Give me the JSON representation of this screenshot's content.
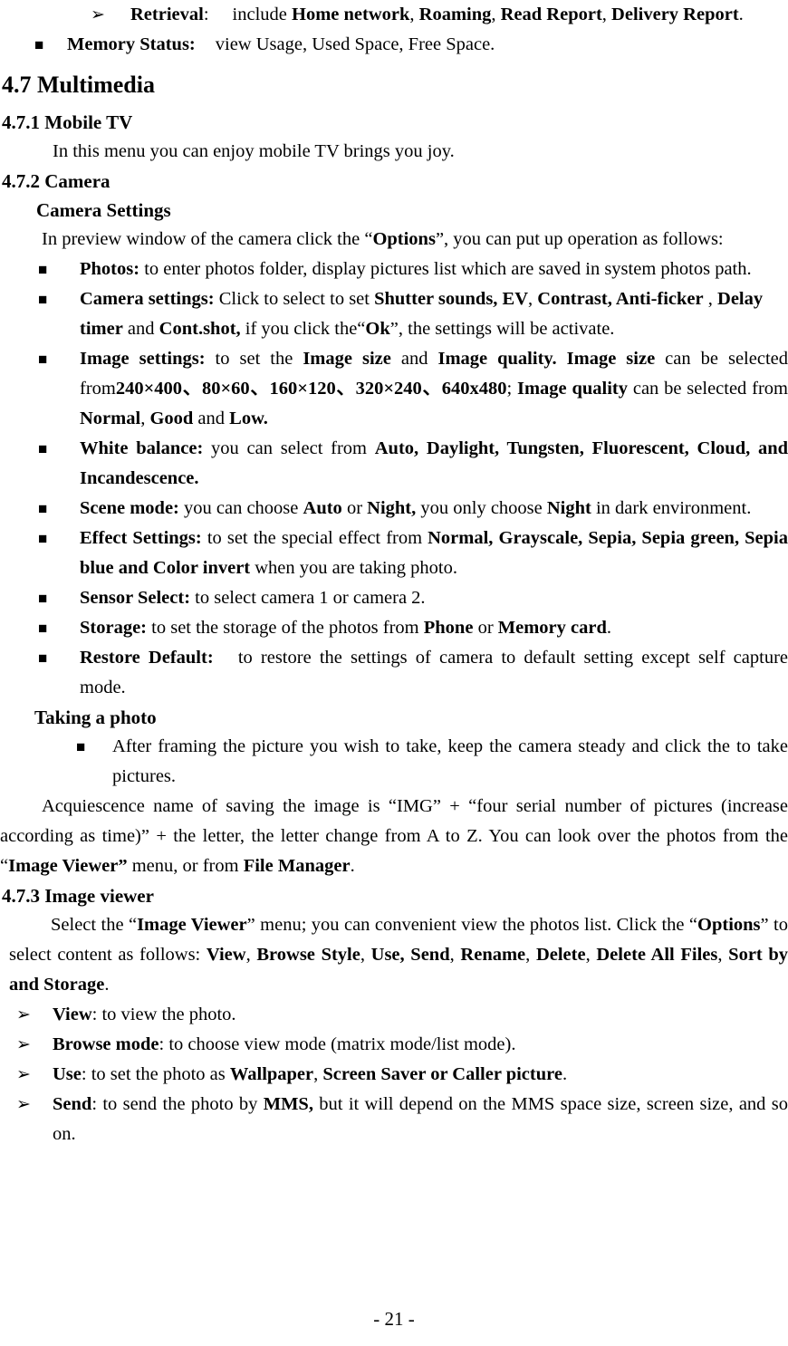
{
  "page": {
    "page_number": "- 21 -",
    "bullet_glyphs": {
      "square": "■",
      "arrow": "➢"
    }
  },
  "top_section": {
    "retrieval": {
      "label": "Retrieval",
      "sep": ":",
      "line1_plain_1": "include ",
      "line1_bold_1": "Home network",
      "line1_plain_2": ", ",
      "line1_bold_2": "Roaming",
      "line1_plain_3": ", ",
      "line1_bold_3": "Read Report",
      "line1_plain_4": ",",
      "line2_bold": "Delivery Report",
      "line2_plain": "."
    },
    "memory_status": {
      "label": "Memory Status:",
      "text": "view Usage, Used Space, Free Space."
    }
  },
  "multimedia": {
    "heading": "4.7 Multimedia",
    "mobile_tv": {
      "heading": "4.7.1 Mobile TV",
      "body": "In this menu you can enjoy mobile TV brings you joy."
    },
    "camera": {
      "heading": "4.7.2 Camera",
      "settings_heading": "Camera Settings",
      "intro_1": "In preview window of the camera click the “",
      "intro_bold": "Options",
      "intro_2": "”, you can put up operation as follows:",
      "items": [
        {
          "label": "Photos:",
          "body_plain": " to enter photos folder, display pictures list which are saved in system photos path."
        },
        {
          "label": "Camera settings:",
          "p1": " Click to select to set ",
          "b1": "Shutter sounds, EV",
          "p2": ", ",
          "b2": "Contrast, Anti-ficker",
          "p3": " , ",
          "b3": "Delay timer",
          "p4": " and ",
          "b4": "Cont.shot,",
          "p5": " if you click the“",
          "b5": "Ok",
          "p6": "”, the settings will be activate."
        },
        {
          "label": "Image settings:",
          "p1": " to set the ",
          "b1": "Image size",
          "p2": " and ",
          "b2": "Image quality. Image size",
          "p3": " can be selected from",
          "b3": "240×400、80×60、160×120、320×240、640x480",
          "p4": "; ",
          "b4": "Image quality",
          "p5": " can be selected from ",
          "b5": "Normal",
          "p6": ", ",
          "b6": "Good",
          "p7": " and ",
          "b7": "Low."
        },
        {
          "label": "White balance:",
          "p1": " you can select from ",
          "b1": "Auto, Daylight, Tungsten, Fluorescent, Cloud, and Incandescence."
        },
        {
          "label": "Scene mode:",
          "p1": " you can choose ",
          "b1": "Auto",
          "p2": " or ",
          "b2": "Night,",
          "p3": " you only choose ",
          "b3": "Night",
          "p4": " in dark environment."
        },
        {
          "label": "Effect Settings:",
          "p1": " to set the special effect from ",
          "b1": "Normal, Grayscale, Sepia, Sepia green, Sepia blue and Color invert",
          "p2": " when you are taking photo."
        },
        {
          "label": "Sensor Select:",
          "p1": " to select camera 1 or camera 2."
        },
        {
          "label": "Storage:",
          "p1": " to set the storage of the photos from ",
          "b1": "Phone",
          "p2": " or ",
          "b2": "Memory card",
          "p3": "."
        },
        {
          "label": "Restore Default:",
          "p1": "  to restore the settings of camera to default setting except self capture mode."
        }
      ],
      "taking_photo": {
        "heading": "Taking a photo",
        "bullet_text": "After framing the picture you wish to take, keep the camera steady and click the   to take pictures.",
        "para_1": "Acquiescence name of saving the image is “IMG” + “four serial number of pictures (increase according as time)” + the letter, the letter change from A to Z. You can look over the photos from the “",
        "para_bold_1": "Image Viewer”",
        "para_2": " menu, or from ",
        "para_bold_2": "File Manager",
        "para_3": "."
      }
    },
    "image_viewer": {
      "heading": "4.7.3 Image viewer",
      "intro_1": "Select the “",
      "intro_b1": "Image Viewer",
      "intro_2": "” menu; you can convenient view the photos list. Click the “",
      "intro_b2": "Options",
      "intro_3": "” to select content as follows: ",
      "intro_b3": "View",
      "intro_4": ", ",
      "intro_b4": "Browse Style",
      "intro_5": ", ",
      "intro_b5": "Use, Send",
      "intro_6": ", ",
      "intro_b6": "Rename",
      "intro_7": ", ",
      "intro_b7": "Delete",
      "intro_8": ", ",
      "intro_b8": "Delete All Files",
      "intro_9": ", ",
      "intro_b9": "Sort by and Storage",
      "intro_10": ".",
      "items": [
        {
          "label": "View",
          "p1": ": to view the photo."
        },
        {
          "label": "Browse mode",
          "p1": ": to choose view mode (matrix mode/list mode)."
        },
        {
          "label": "Use",
          "p1": ": to set the photo as ",
          "b1": "Wallpaper",
          "p2": ", ",
          "b2": "Screen Saver or Caller picture",
          "p3": "."
        },
        {
          "label": "Send",
          "p1": ": to send the photo by ",
          "b1": "MMS,",
          "p2": " but it will depend on the MMS space size, screen size, and so on."
        }
      ]
    }
  }
}
